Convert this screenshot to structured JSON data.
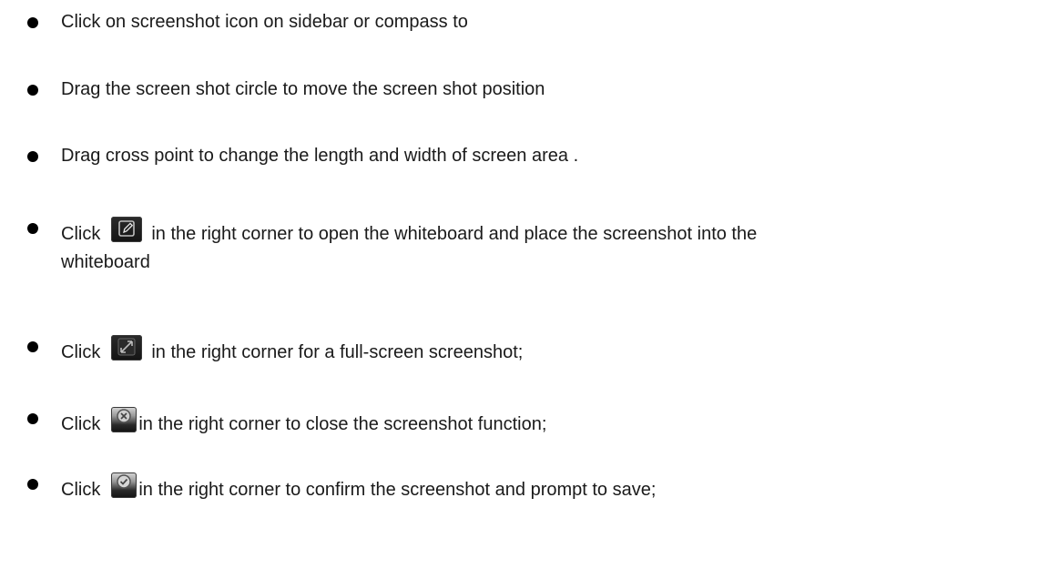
{
  "instructions": [
    {
      "text": "Click on screenshot icon on sidebar or compass to"
    },
    {
      "text": "Drag the screen shot circle to move the screen shot position"
    },
    {
      "text": "Drag cross point to change the length and width of screen area ."
    },
    {
      "before": "Click",
      "icon": "whiteboard-edit-icon",
      "after": "in the right corner to open the whiteboard and place the screenshot into the",
      "continuation": "whiteboard"
    },
    {
      "before": "Click",
      "icon": "fullscreen-icon",
      "after": "in the right corner for a full-screen screenshot;"
    },
    {
      "before": "Click",
      "icon": "close-circle-icon",
      "after": "in the right corner to close the screenshot function;"
    },
    {
      "before": "Click",
      "icon": "confirm-check-icon",
      "after": "in the right corner to confirm the screenshot and prompt to save;"
    }
  ]
}
